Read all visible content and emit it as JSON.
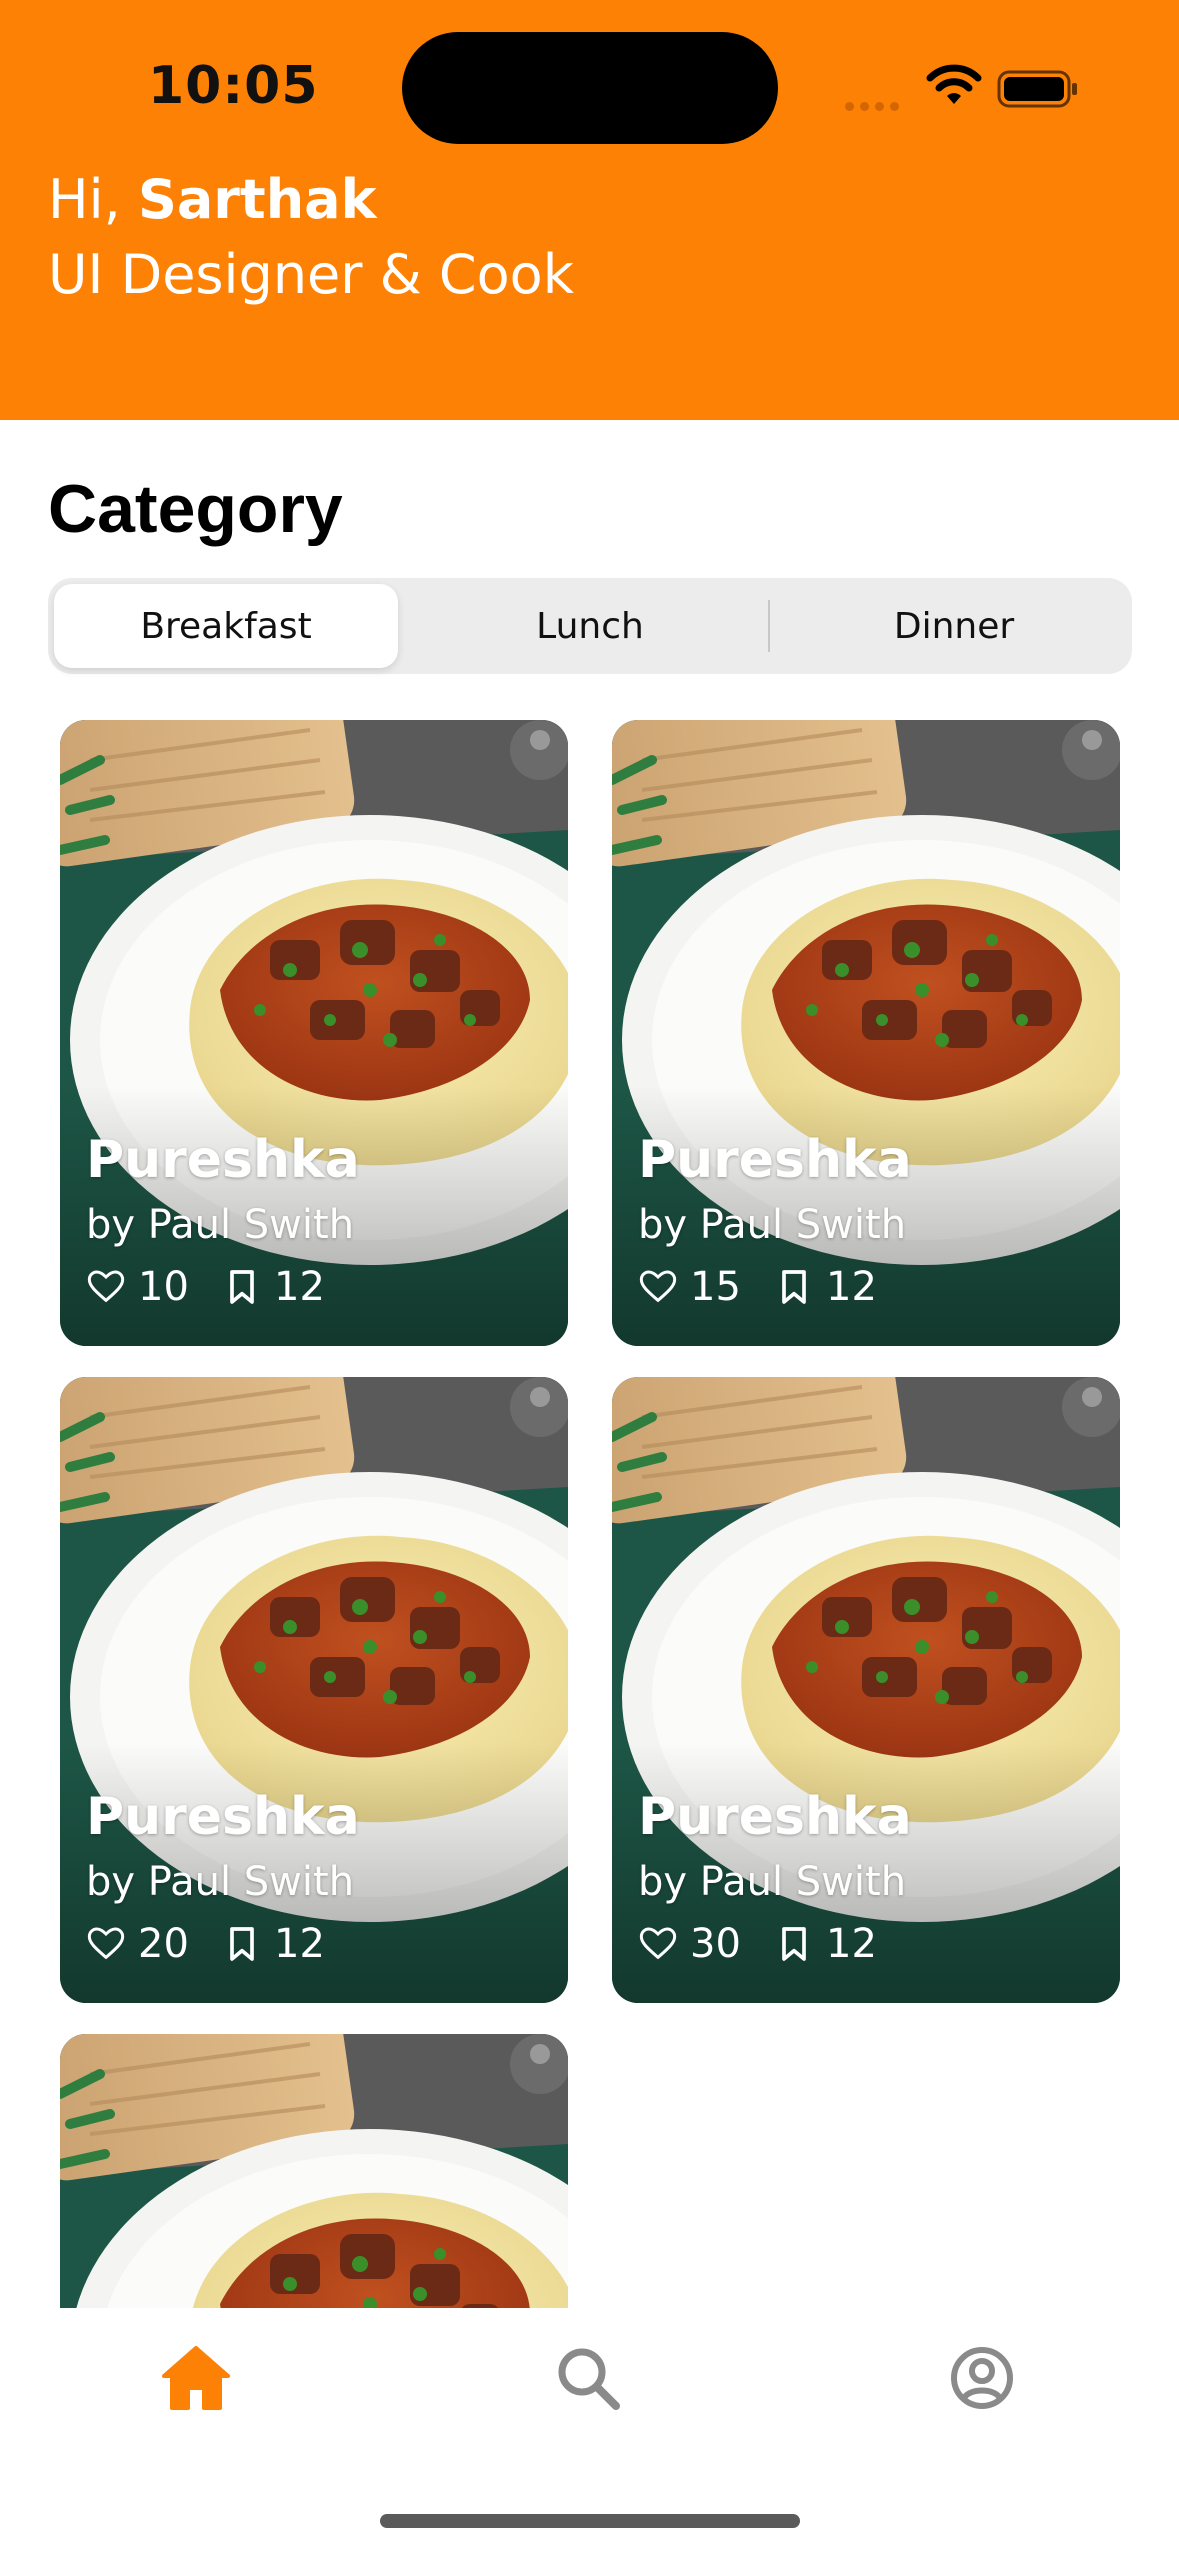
{
  "status_bar": {
    "time": "10:05"
  },
  "header": {
    "greeting_prefix": "Hi,",
    "user_name": "Sarthak",
    "subtitle": "UI Designer & Cook"
  },
  "category": {
    "title": "Category",
    "tabs": [
      {
        "label": "Breakfast",
        "selected": true
      },
      {
        "label": "Lunch",
        "selected": false
      },
      {
        "label": "Dinner",
        "selected": false
      }
    ]
  },
  "recipes": [
    {
      "name": "Pureshka",
      "author": "by Paul Swith",
      "likes": "10",
      "bookmarks": "12"
    },
    {
      "name": "Pureshka",
      "author": "by Paul Swith",
      "likes": "15",
      "bookmarks": "12"
    },
    {
      "name": "Pureshka",
      "author": "by Paul Swith",
      "likes": "20",
      "bookmarks": "12"
    },
    {
      "name": "Pureshka",
      "author": "by Paul Swith",
      "likes": "30",
      "bookmarks": "12"
    }
  ],
  "tab_bar": {
    "items": [
      {
        "icon": "home-icon",
        "active": true
      },
      {
        "icon": "search-icon",
        "active": false
      },
      {
        "icon": "profile-icon",
        "active": false
      }
    ]
  },
  "colors": {
    "accent": "#fd8105",
    "inactive": "#8a8a8a"
  }
}
